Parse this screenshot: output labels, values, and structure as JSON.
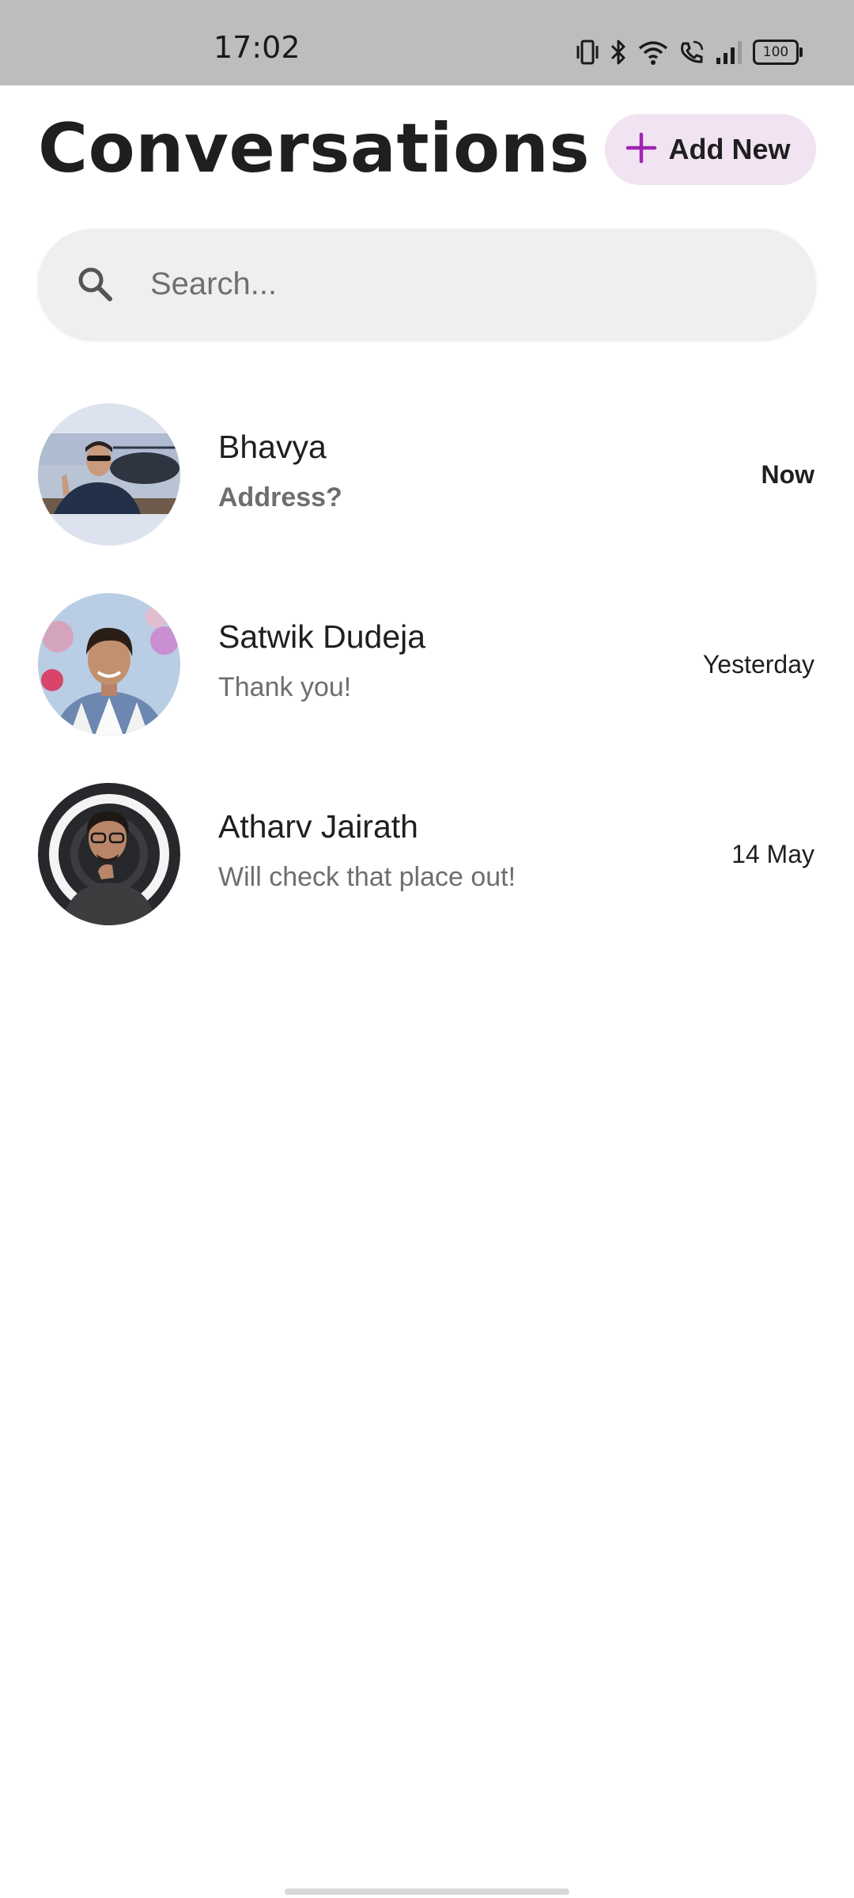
{
  "status_bar": {
    "time": "17:02",
    "battery": "100",
    "icons": [
      "vibrate-icon",
      "bluetooth-icon",
      "wifi-icon",
      "wifi-calling-icon",
      "signal-icon",
      "battery-icon"
    ]
  },
  "header": {
    "title": "Conversations",
    "add_button_label": "Add New",
    "add_icon": "plus-icon",
    "accent_color": "#9c27b0",
    "add_button_bg": "#f2e3f2"
  },
  "search": {
    "placeholder": "Search...",
    "value": "",
    "icon": "search-icon"
  },
  "conversations": [
    {
      "name": "Bhavya",
      "last_message": "Address?",
      "time": "Now",
      "unread": true
    },
    {
      "name": "Satwik Dudeja",
      "last_message": "Thank you!",
      "time": "Yesterday",
      "unread": false
    },
    {
      "name": "Atharv Jairath",
      "last_message": "Will check that place out!",
      "time": "14 May",
      "unread": false
    }
  ]
}
